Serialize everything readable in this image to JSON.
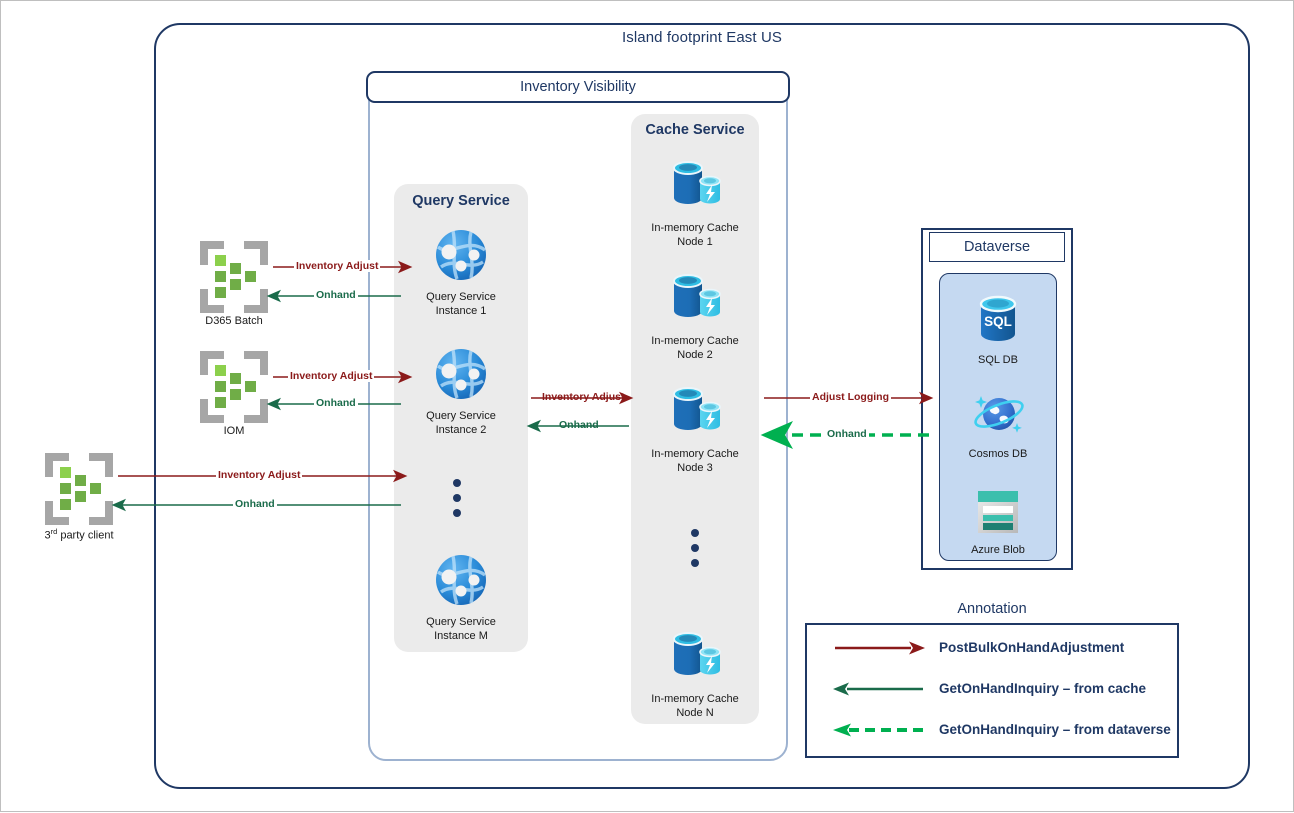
{
  "colors": {
    "navy": "#1F3864",
    "panel_grey": "#ebebeb",
    "dataverse_fill": "#C5D9F1",
    "arrow_red": "#8B1A1A",
    "arrow_green": "#1A6B4A",
    "arrow_green_dashed": "#00B050",
    "client_frame": "#a6a6a6",
    "client_square": "#70AD47",
    "inner_border": "#9DB2D0"
  },
  "island": {
    "title": "Island footprint East US"
  },
  "inventory_visibility": {
    "title": "Inventory Visibility"
  },
  "query_service": {
    "title": "Query Service",
    "nodes": [
      {
        "line1": "Query Service",
        "line2": "Instance 1",
        "icon": "azure-globe-icon"
      },
      {
        "line1": "Query Service",
        "line2": "Instance 2",
        "icon": "azure-globe-icon"
      },
      {
        "line1": "Query Service",
        "line2": "Instance M",
        "icon": "azure-globe-icon"
      }
    ],
    "ellipsis": "vertical-dots"
  },
  "cache_service": {
    "title": "Cache Service",
    "nodes": [
      {
        "line1": "In-memory Cache",
        "line2": "Node 1",
        "icon": "redis-cache-icon"
      },
      {
        "line1": "In-memory Cache",
        "line2": "Node 2",
        "icon": "redis-cache-icon"
      },
      {
        "line1": "In-memory Cache",
        "line2": "Node 3",
        "icon": "redis-cache-icon"
      },
      {
        "line1": "In-memory Cache",
        "line2": "Node N",
        "icon": "redis-cache-icon"
      }
    ],
    "ellipsis": "vertical-dots"
  },
  "dataverse": {
    "title": "Dataverse",
    "stores": [
      {
        "label": "SQL DB",
        "icon": "sql-db-icon",
        "icon_text": "SQL"
      },
      {
        "label": "Cosmos DB",
        "icon": "cosmos-db-icon"
      },
      {
        "label": "Azure Blob",
        "icon": "azure-blob-icon"
      }
    ]
  },
  "clients": [
    {
      "label": "D365 Batch",
      "icon": "app-module-icon"
    },
    {
      "label": "IOM",
      "icon": "app-module-icon"
    },
    {
      "label": "3rd party client",
      "label_prefix": "3",
      "label_sup": "rd",
      "label_rest": " party client",
      "icon": "app-module-icon"
    }
  ],
  "flows": {
    "inventory_adjust": "Inventory Adjust",
    "onhand": "Onhand",
    "adjust_logging": "Adjust Logging"
  },
  "legend": {
    "title": "Annotation",
    "rows": [
      {
        "label": "PostBulkOnHandAdjustment",
        "arrow": "solid-right-arrow-red",
        "color": "#8B1A1A",
        "direction": "right",
        "style": "solid"
      },
      {
        "label": "GetOnHandInquiry – from cache",
        "arrow": "solid-left-arrow-green",
        "color": "#1A6B4A",
        "direction": "left",
        "style": "solid"
      },
      {
        "label": "GetOnHandInquiry – from dataverse",
        "arrow": "dashed-left-arrow-green",
        "color": "#00B050",
        "direction": "left",
        "style": "dashed"
      }
    ]
  }
}
